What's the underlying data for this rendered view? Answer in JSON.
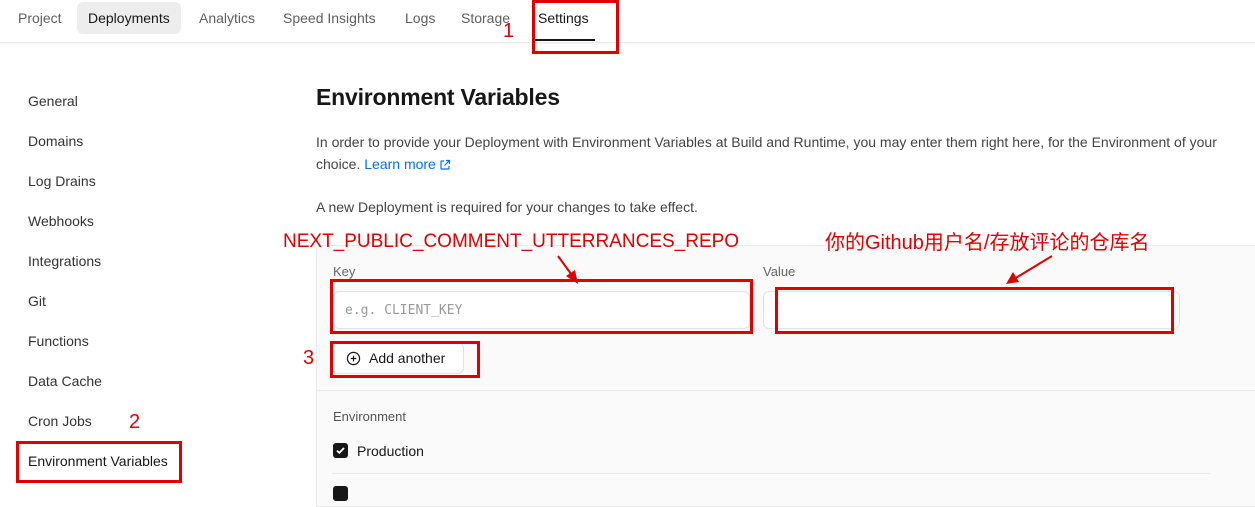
{
  "tabs": [
    {
      "label": "Project"
    },
    {
      "label": "Deployments"
    },
    {
      "label": "Analytics"
    },
    {
      "label": "Speed Insights"
    },
    {
      "label": "Logs"
    },
    {
      "label": "Storage"
    },
    {
      "label": "Settings"
    }
  ],
  "sidebar": {
    "items": [
      {
        "label": "General"
      },
      {
        "label": "Domains"
      },
      {
        "label": "Log Drains"
      },
      {
        "label": "Webhooks"
      },
      {
        "label": "Integrations"
      },
      {
        "label": "Git"
      },
      {
        "label": "Functions"
      },
      {
        "label": "Data Cache"
      },
      {
        "label": "Cron Jobs"
      },
      {
        "label": "Environment Variables"
      }
    ]
  },
  "main": {
    "title": "Environment Variables",
    "description": "In order to provide your Deployment with Environment Variables at Build and Runtime, you may enter them right here, for the Environment of your choice.",
    "learn_more": "Learn more",
    "note": "A new Deployment is required for your changes to take effect.",
    "form": {
      "key_label": "Key",
      "key_placeholder": "e.g. CLIENT_KEY",
      "key_value": "",
      "value_label": "Value",
      "value_value": "",
      "add_another": "Add another",
      "environment_label": "Environment",
      "environments": [
        {
          "label": "Production",
          "checked": true
        }
      ]
    }
  },
  "annotations": {
    "num1": "1",
    "num2": "2",
    "num3": "3",
    "key_hint": "NEXT_PUBLIC_COMMENT_UTTERRANCES_REPO",
    "value_hint": "你的Github用户名/存放评论的仓库名",
    "color": "#e00000"
  },
  "colors": {
    "accent_link": "#0070f3",
    "active_tab_bg": "#ededed",
    "checkbox": "#171717"
  }
}
